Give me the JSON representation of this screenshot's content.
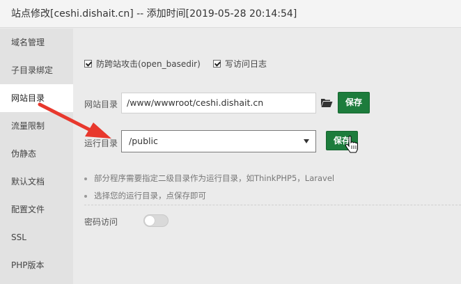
{
  "window": {
    "title": "站点修改[ceshi.dishait.cn] -- 添加时间[2019-05-28 20:14:54]"
  },
  "sidebar": {
    "items": [
      {
        "label": "域名管理"
      },
      {
        "label": "子目录绑定"
      },
      {
        "label": "网站目录",
        "active": true
      },
      {
        "label": "流量限制"
      },
      {
        "label": "伪静态"
      },
      {
        "label": "默认文档"
      },
      {
        "label": "配置文件"
      },
      {
        "label": "SSL"
      },
      {
        "label": "PHP版本"
      }
    ]
  },
  "options": {
    "anti_xss": {
      "label": "防跨站攻击(open_basedir)",
      "checked": true
    },
    "access_log": {
      "label": "写访问日志",
      "checked": true
    }
  },
  "site_dir": {
    "label": "网站目录",
    "value": "/www/wwwroot/ceshi.dishait.cn",
    "folder_icon": "folder-open-icon",
    "save_label": "保存"
  },
  "run_dir": {
    "label": "运行目录",
    "selected": "/public",
    "save_label": "保存"
  },
  "notes": [
    "部分程序需要指定二级目录作为运行目录，如ThinkPHP5，Laravel",
    "选择您的运行目录，点保存即可"
  ],
  "password_access": {
    "label": "密码访问",
    "enabled": false
  },
  "colors": {
    "accent": "#1d7c3c",
    "annotation_arrow": "#e8382d"
  }
}
